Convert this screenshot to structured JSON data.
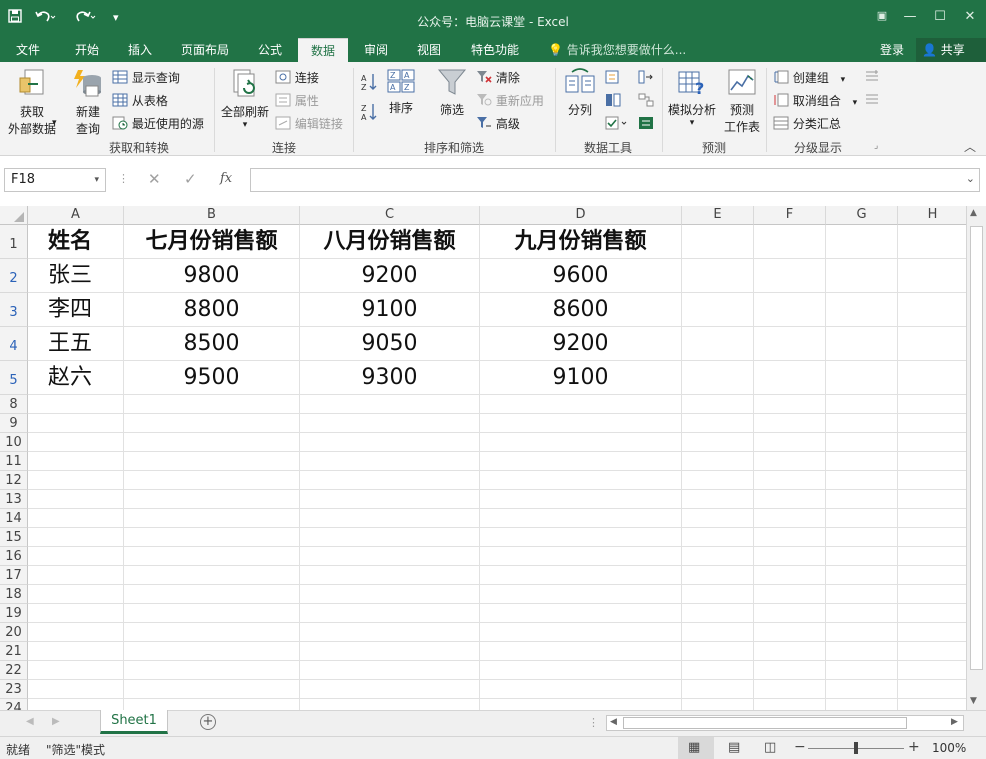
{
  "titlebar": {
    "title": "公众号：电脑云课堂 - Excel",
    "save_icon": "save-icon",
    "undo_icon": "undo-icon",
    "redo_icon": "redo-icon"
  },
  "tabs": [
    "文件",
    "开始",
    "插入",
    "页面布局",
    "公式",
    "数据",
    "审阅",
    "视图",
    "特色功能"
  ],
  "active_tab": "数据",
  "tellme": "告诉我您想要做什么...",
  "login": "登录",
  "share": "共享",
  "ribbon": {
    "get_external": [
      "获取",
      "外部数据"
    ],
    "new_query": [
      "新建",
      "查询"
    ],
    "show_queries": "显示查询",
    "from_table": "从表格",
    "recent_sources": "最近使用的源",
    "group1": "获取和转换",
    "refresh_all": "全部刷新",
    "connections": "连接",
    "properties": "属性",
    "edit_links": "编辑链接",
    "group2": "连接",
    "sort": "排序",
    "filter": "筛选",
    "clear": "清除",
    "reapply": "重新应用",
    "advanced": "高级",
    "group3": "排序和筛选",
    "text_to_columns": "分列",
    "group4": "数据工具",
    "what_if": "模拟分析",
    "forecast_sheet": [
      "预测",
      "工作表"
    ],
    "group5": "预测",
    "group_cmd": "创建组",
    "ungroup": "取消组合",
    "subtotal": "分类汇总",
    "group6": "分级显示"
  },
  "formula_bar": {
    "name_box": "F18",
    "fx_label": "fx",
    "value": ""
  },
  "columns": [
    "A",
    "B",
    "C",
    "D",
    "E",
    "F",
    "G",
    "H"
  ],
  "row_numbers": [
    "1",
    "2",
    "3",
    "4",
    "5",
    "8",
    "9",
    "10",
    "11",
    "12",
    "13",
    "14",
    "15",
    "16",
    "17",
    "18",
    "19",
    "20",
    "21",
    "22",
    "23",
    "24"
  ],
  "table": {
    "headers": [
      "姓名",
      "七月份销售额",
      "八月份销售额",
      "九月份销售额"
    ],
    "rows": [
      [
        "张三",
        "9800",
        "9200",
        "9600"
      ],
      [
        "李四",
        "8800",
        "9100",
        "8600"
      ],
      [
        "王五",
        "8500",
        "9050",
        "9200"
      ],
      [
        "赵六",
        "9500",
        "9300",
        "9100"
      ]
    ]
  },
  "sheet_tab": "Sheet1",
  "status": {
    "ready": "就绪",
    "mode": "\"筛选\"模式",
    "zoom": "100%"
  },
  "colors": {
    "excel_green": "#217346",
    "row_number_blue": "#2b62b8"
  }
}
